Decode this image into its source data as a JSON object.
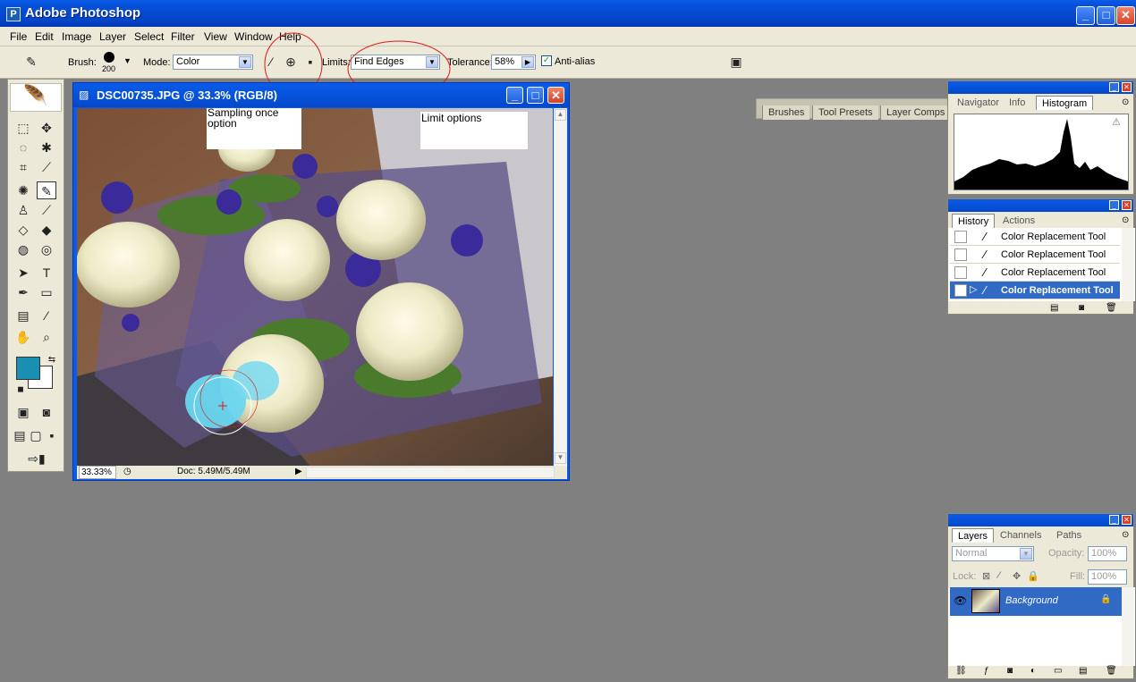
{
  "app": {
    "title": "Adobe Photoshop"
  },
  "menu": [
    "File",
    "Edit",
    "Image",
    "Layer",
    "Select",
    "Filter",
    "View",
    "Window",
    "Help"
  ],
  "options": {
    "brush_label": "Brush:",
    "brush_size": "200",
    "mode_label": "Mode:",
    "mode_value": "Color",
    "limits_label": "Limits:",
    "limits_value": "Find Edges",
    "tolerance_label": "Tolerance:",
    "tolerance_value": "58%",
    "antialias_label": "Anti-alias",
    "antialias_checked": true
  },
  "palette_well": [
    "Brushes",
    "Tool Presets",
    "Layer Comps"
  ],
  "document": {
    "title": "DSC00735.JPG @ 33.3% (RGB/8)",
    "zoom": "33.33%",
    "doc_info": "Doc: 5.49M/5.49M"
  },
  "callouts": {
    "sampling": "Sampling once option",
    "limits": "Limit options"
  },
  "colors": {
    "foreground": "#1a8fb4",
    "background": "#ffffff",
    "accent": "#316ac5"
  },
  "histogram_panel": {
    "tabs": [
      "Navigator",
      "Info",
      "Histogram"
    ],
    "active": "Histogram"
  },
  "history_panel": {
    "tabs": [
      "History",
      "Actions"
    ],
    "items": [
      "Color Replacement Tool",
      "Color Replacement Tool",
      "Color Replacement Tool",
      "Color Replacement Tool"
    ],
    "active_index": 3
  },
  "layers_panel": {
    "tabs": [
      "Layers",
      "Channels",
      "Paths"
    ],
    "blend_mode": "Normal",
    "opacity_label": "Opacity:",
    "opacity_value": "100%",
    "lock_label": "Lock:",
    "fill_label": "Fill:",
    "fill_value": "100%",
    "layer_name": "Background"
  }
}
